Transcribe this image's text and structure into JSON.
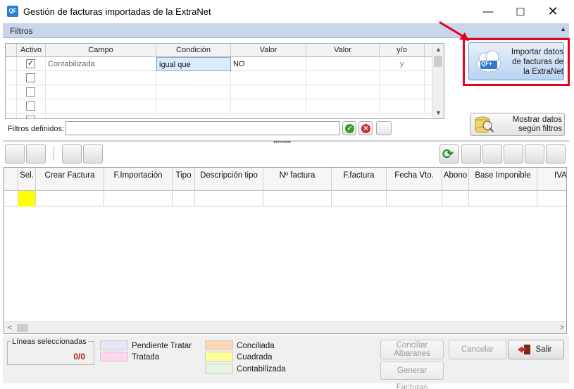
{
  "window": {
    "title": "Gestión de facturas importadas de la ExtraNet",
    "app_icon": "QF",
    "min_glyph": "—",
    "max_glyph": "☐",
    "close_glyph": "✕"
  },
  "filters": {
    "section_label": "Filtros",
    "collapse_glyph": "▲",
    "columns": [
      "Activo",
      "Campo",
      "Condición",
      "Valor",
      "Valor",
      "y/o"
    ],
    "rows": [
      {
        "checked": true,
        "campo": "Contabilizada",
        "condicion": "igual que",
        "valor1": "NO",
        "valor2": "",
        "yo": "y"
      },
      {
        "checked": false,
        "campo": "",
        "condicion": "",
        "valor1": "",
        "valor2": "",
        "yo": ""
      },
      {
        "checked": false,
        "campo": "",
        "condicion": "",
        "valor1": "",
        "valor2": "",
        "yo": ""
      },
      {
        "checked": false,
        "campo": "",
        "condicion": "",
        "valor1": "",
        "valor2": "",
        "yo": ""
      },
      {
        "checked": false,
        "campo": "",
        "condicion": "",
        "valor1": "",
        "valor2": "",
        "yo": ""
      }
    ],
    "check_glyph": "✓",
    "scroll_up": "▲",
    "scroll_down": "▼",
    "defined_label": "Filtros definidos:",
    "defined_value": ""
  },
  "import_button": {
    "label": "Importar datos de facturas de la ExtraNet",
    "line1": "Importar datos",
    "line2": "de facturas de",
    "line3": "la ExtraNet",
    "icon_text": "QF+"
  },
  "show_button": {
    "line1": "Mostrar datos",
    "line2": "según filtros"
  },
  "splitter_grip": "•••••••••",
  "toolbar": {
    "refresh_glyph": "⟳"
  },
  "grid": {
    "columns": [
      "Sel.",
      "Crear Factura",
      "F.Importación",
      "Tipo",
      "Descripción tipo",
      "Nº factura",
      "F.factura",
      "Fecha Vto.",
      "Abono",
      "Base Imponible",
      "IVA"
    ],
    "scroll_left": "<",
    "scroll_right": ">"
  },
  "footer": {
    "lines_label": "Líneas seleccionadas",
    "lines_count": "0/0",
    "legend": [
      {
        "label": "Pendiente Tratar",
        "color": "#e6e6f8"
      },
      {
        "label": "Tratada",
        "color": "#ffd6ee"
      },
      {
        "label": "Conciliada",
        "color": "#ffd6b4"
      },
      {
        "label": "Cuadrada",
        "color": "#ffff99"
      },
      {
        "label": "Contabilizada",
        "color": "#e6f5e0"
      }
    ],
    "conciliar_line1": "Conciliar",
    "conciliar_line2": "Albaranes",
    "generar": "Generar Facturas",
    "cancelar": "Cancelar",
    "salir": "Salir"
  },
  "colors": {
    "highlight_border": "#e8001c",
    "arrow": "#e8001c",
    "selection": "#ffff00"
  }
}
